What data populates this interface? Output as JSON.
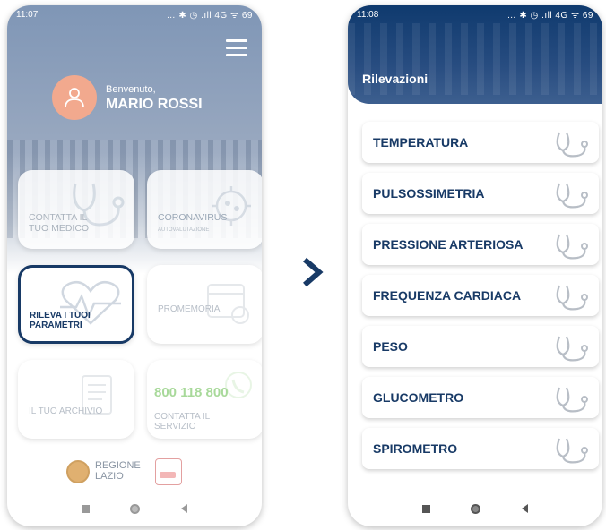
{
  "phone1": {
    "status_time": "11:07",
    "status_icons": "… ✱ ◷ .ıll 4G ᯤ 69",
    "welcome_line1": "Benvenuto,",
    "welcome_name": "MARIO ROSSI",
    "tiles": {
      "medico": "CONTATTA IL\nTUO MEDICO",
      "corona": "CORONAVIRUS",
      "corona_sub": "AUTOVALUTAZIONE",
      "rileva": "RILEVA I TUOI\nPARAMETRI",
      "promemoria": "PROMEMORIA",
      "archivio": "IL TUO ARCHIVIO",
      "number": "800 118 800",
      "servizio": "CONTATTA IL\nSERVIZIO"
    },
    "footer_logo_text": "REGIONE\nLAZIO"
  },
  "phone2": {
    "status_time": "11:08",
    "status_icons": "… ✱ ◷ .ıll 4G ᯤ 69",
    "title": "Rilevazioni",
    "items": [
      "TEMPERATURA",
      "PULSOSSIMETRIA",
      "PRESSIONE ARTERIOSA",
      "FREQUENZA CARDIACA",
      "PESO",
      "GLUCOMETRO",
      "SPIROMETRO"
    ]
  },
  "icons": {
    "menu": "hamburger-icon",
    "avatar": "user-icon",
    "next": "chevron-right-icon",
    "item": "stethoscope-icon",
    "nav": [
      "square-icon",
      "circle-icon",
      "back-icon"
    ]
  },
  "colors": {
    "primary": "#183a66",
    "accent": "#f2a98e",
    "green": "#a8d99a"
  }
}
